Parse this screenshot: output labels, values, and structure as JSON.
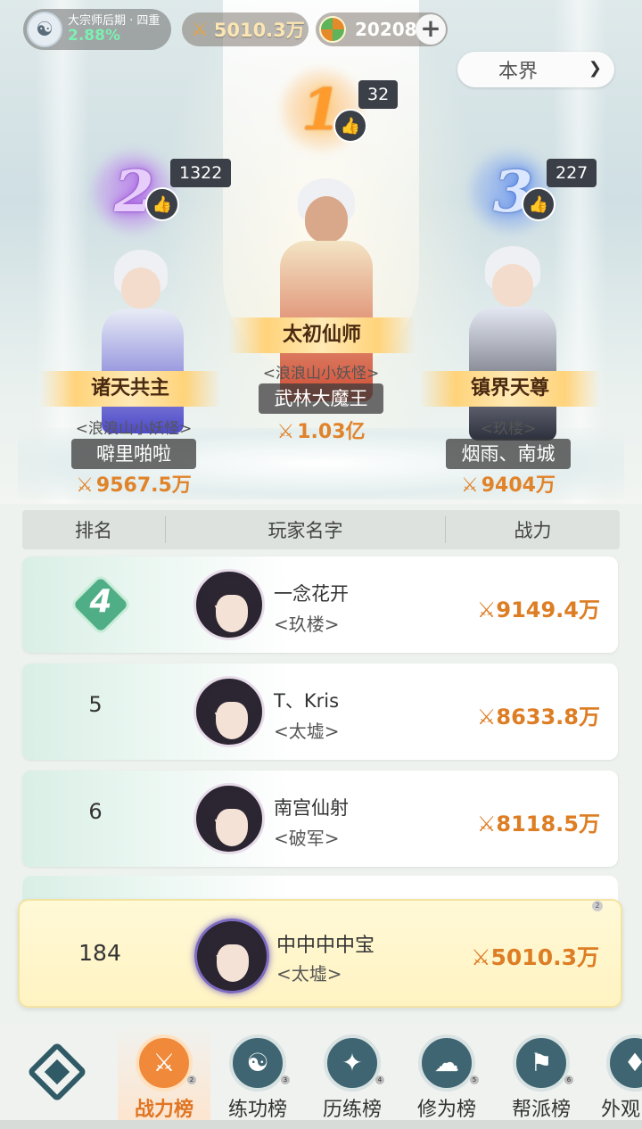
{
  "topbar": {
    "realm_name": "大宗师后期 · 四重",
    "realm_progress": "2.88%",
    "power": "5010.3万",
    "currency": "20208",
    "plus_label": "+"
  },
  "scope_select": {
    "value": "本界"
  },
  "podium": [
    {
      "rank": "1",
      "likes": "32",
      "title": "太初仙师",
      "guild": "<浪浪山小妖怪>",
      "name": "武林大魔王",
      "power": "1.03亿"
    },
    {
      "rank": "2",
      "likes": "1322",
      "title": "诸天共主",
      "guild": "<浪浪山小妖怪>",
      "name": "噼里啪啦",
      "power": "9567.5万"
    },
    {
      "rank": "3",
      "likes": "227",
      "title": "镇界天尊",
      "guild": "<玖楼>",
      "name": "烟雨、南城",
      "power": "9404万"
    }
  ],
  "table": {
    "headers": [
      "排名",
      "玩家名字",
      "战力"
    ],
    "rows": [
      {
        "rank": "4",
        "name": "一念花开",
        "guild": "<玖楼>",
        "power": "9149.4万"
      },
      {
        "rank": "5",
        "name": "T、Kris",
        "guild": "<太墟>",
        "power": "8633.8万"
      },
      {
        "rank": "6",
        "name": "南宫仙射",
        "guild": "<破军>",
        "power": "8118.5万"
      }
    ],
    "self": {
      "rank": "184",
      "name": "中中中中宝",
      "guild": "<太墟>",
      "power": "5010.3万",
      "badge": "2"
    }
  },
  "bottom_nav": [
    {
      "label": "战力榜",
      "icon": "crossed-swords-icon",
      "badge": "2",
      "active": true
    },
    {
      "label": "练功榜",
      "icon": "yin-yang-icon",
      "badge": "3",
      "active": false
    },
    {
      "label": "历练榜",
      "icon": "shuriken-icon",
      "badge": "4",
      "active": false
    },
    {
      "label": "修为榜",
      "icon": "meditation-icon",
      "badge": "5",
      "active": false
    },
    {
      "label": "帮派榜",
      "icon": "banner-icon",
      "badge": "6",
      "active": false
    },
    {
      "label": "外观",
      "icon": "appearance-icon",
      "badge": "",
      "active": false
    }
  ],
  "colors": {
    "power_orange": "#dd7d24",
    "rank1": "#ff9b2c",
    "rank2": "#a24ee0",
    "rank3": "#4a7de6",
    "self_row_bg": "#fff6c8",
    "nav_dark": "#2f5a66"
  }
}
